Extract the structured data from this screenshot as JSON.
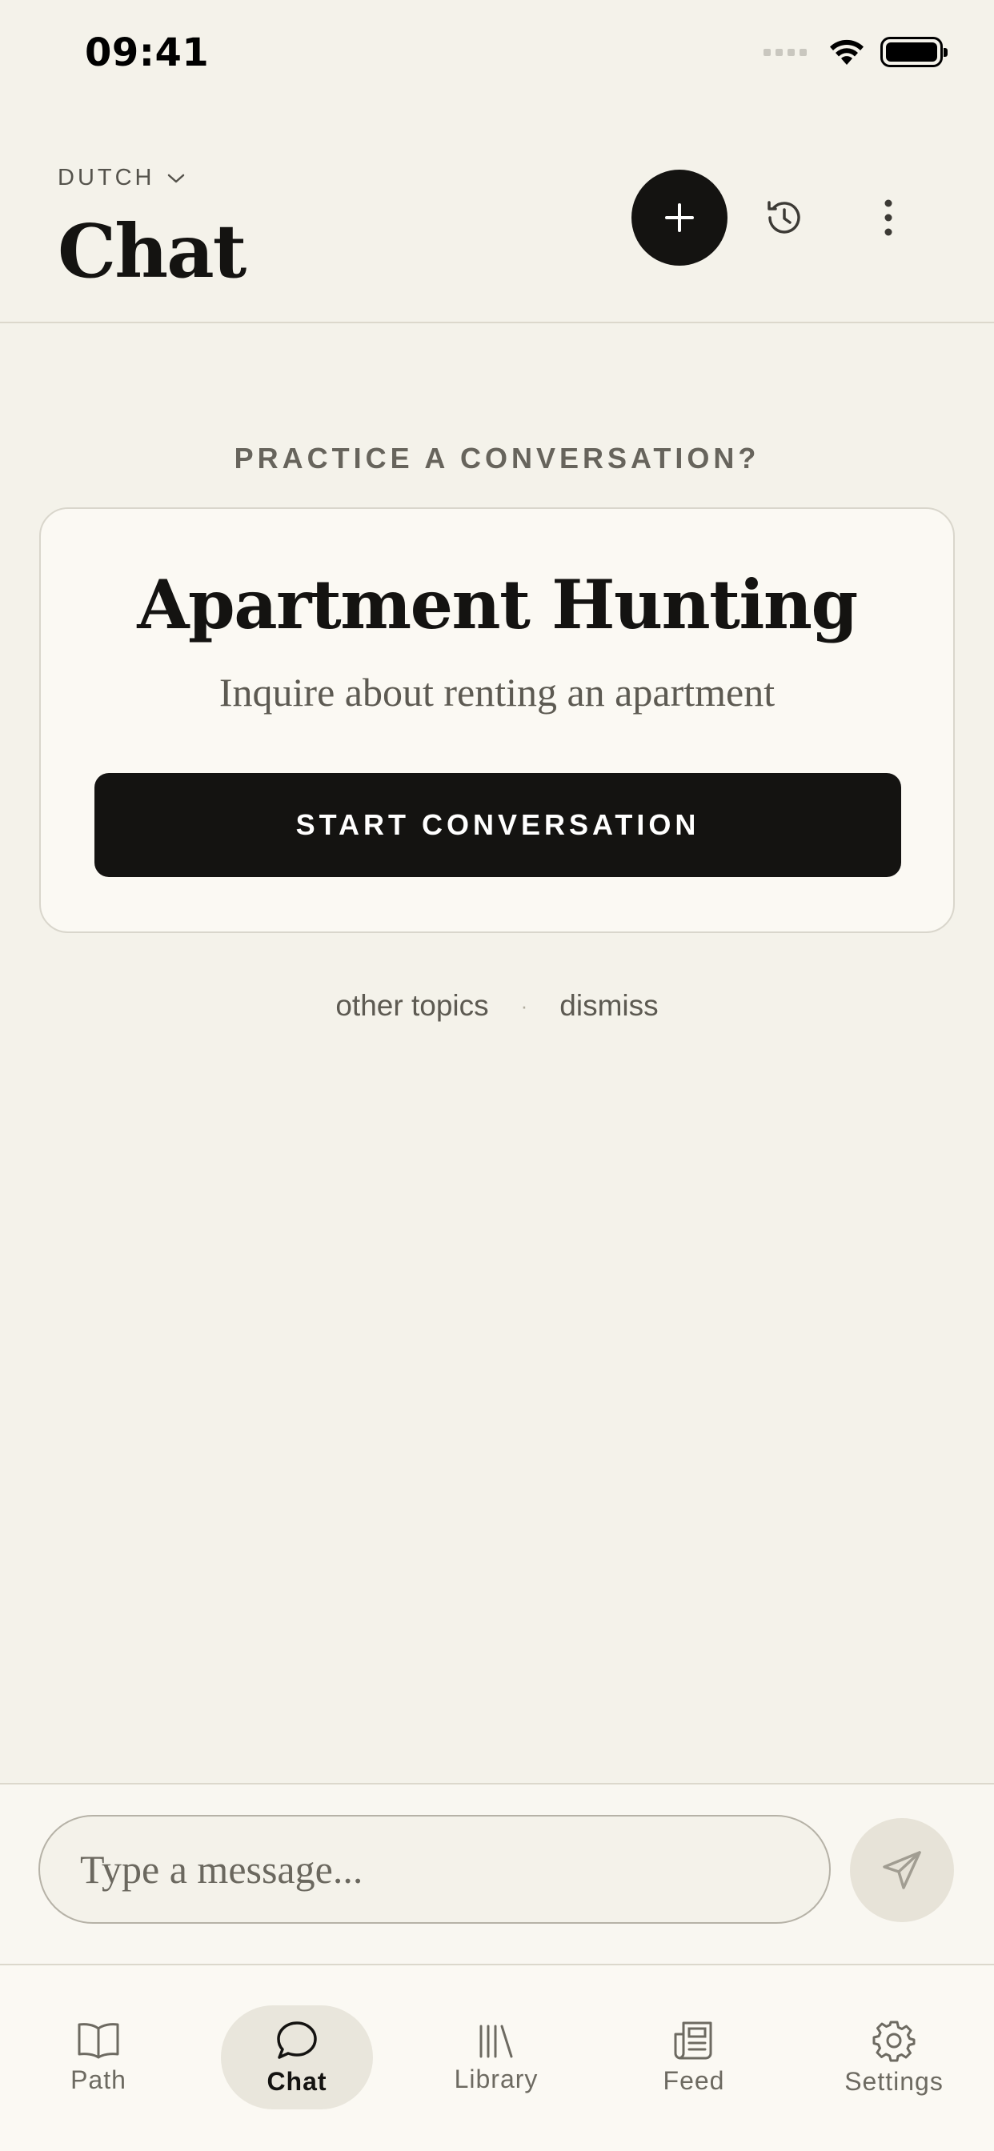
{
  "status_bar": {
    "time": "09:41"
  },
  "header": {
    "language": "DUTCH",
    "title": "Chat"
  },
  "suggestion": {
    "prompt": "PRACTICE A CONVERSATION?",
    "title": "Apartment Hunting",
    "subtitle": "Inquire about renting an apartment",
    "start_label": "START CONVERSATION",
    "other_topics_label": "other topics",
    "separator": "·",
    "dismiss_label": "dismiss"
  },
  "composer": {
    "placeholder": "Type a message..."
  },
  "tabs": [
    {
      "label": "Path",
      "icon": "book-icon",
      "active": false
    },
    {
      "label": "Chat",
      "icon": "chat-bubble-icon",
      "active": true
    },
    {
      "label": "Library",
      "icon": "library-icon",
      "active": false
    },
    {
      "label": "Feed",
      "icon": "newspaper-icon",
      "active": false
    },
    {
      "label": "Settings",
      "icon": "gear-icon",
      "active": false
    }
  ],
  "colors": {
    "background": "#f4f2ea",
    "card": "#fbf9f3",
    "primary": "#141311",
    "muted_text": "#5d5a52",
    "active_tab": "#e9e6dc"
  }
}
